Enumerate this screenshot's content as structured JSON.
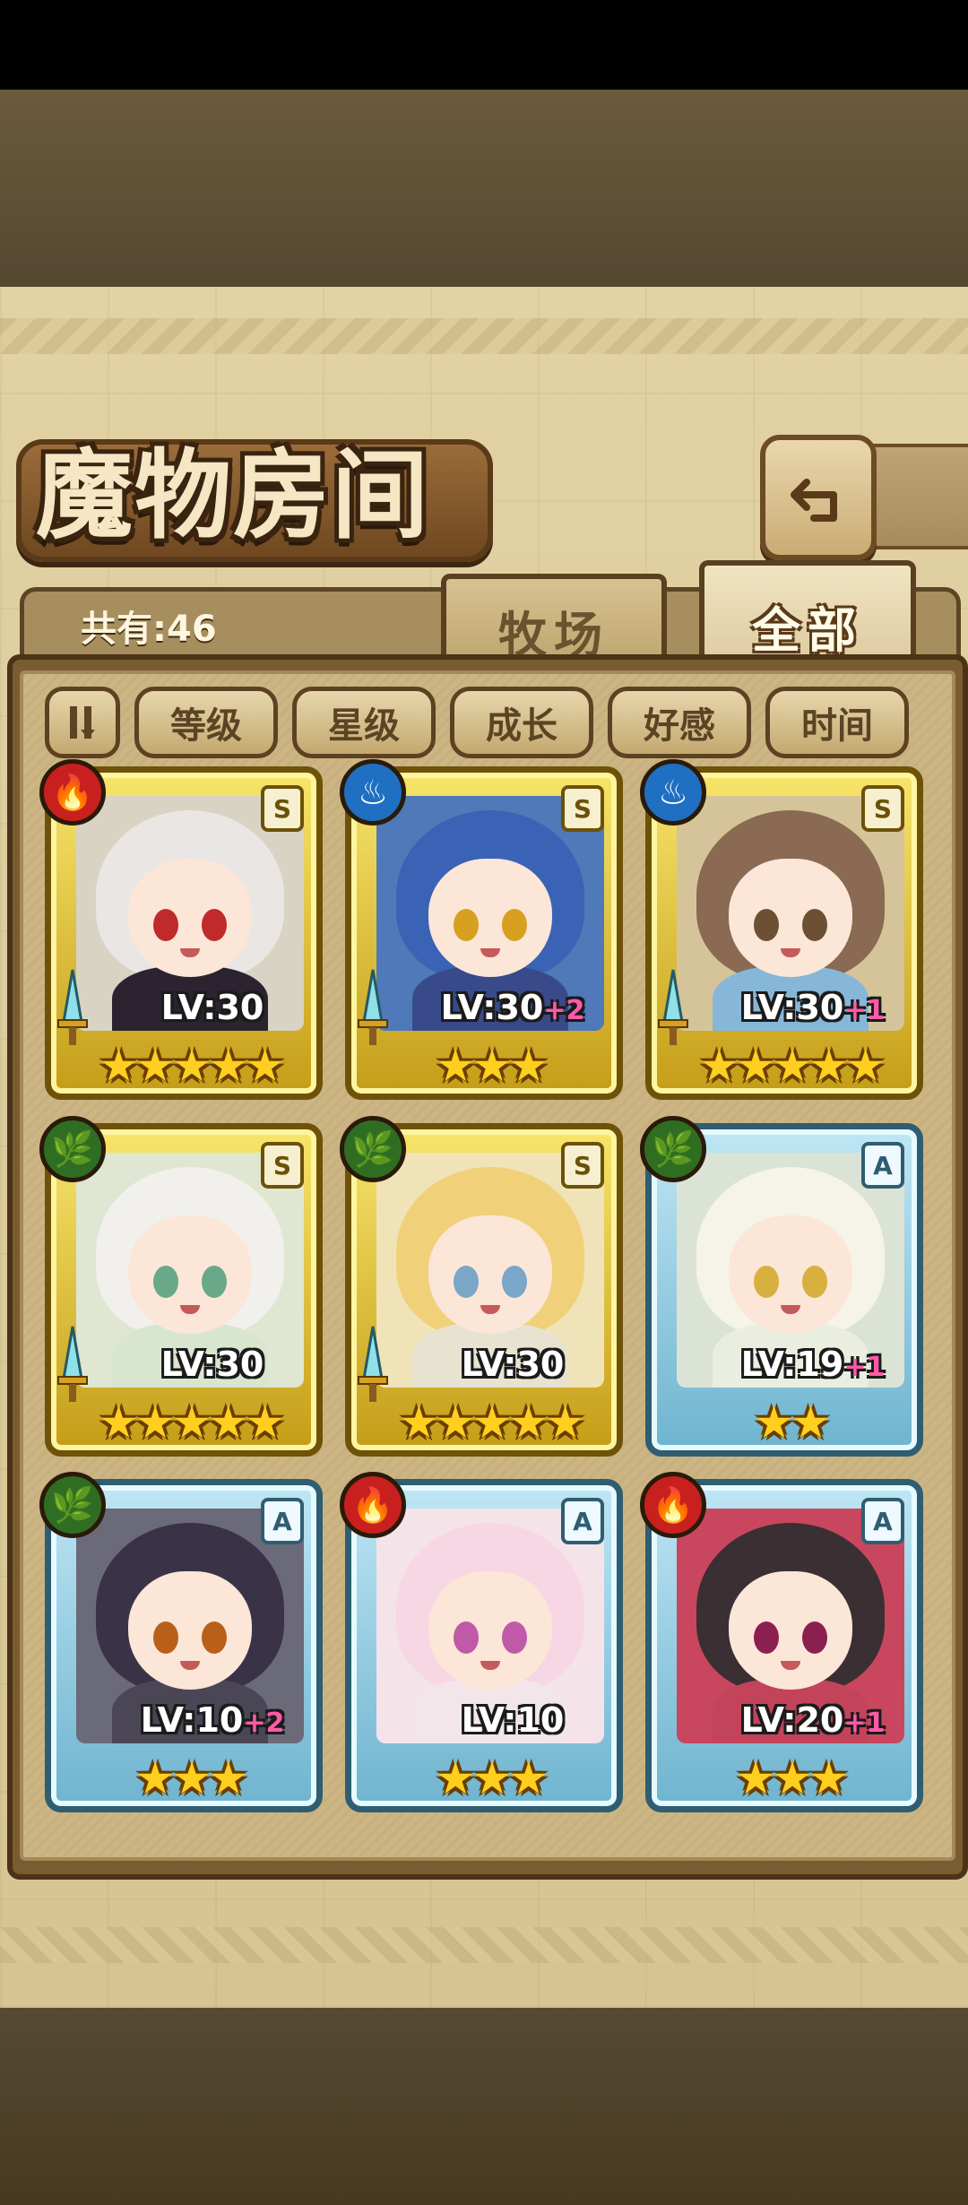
{
  "header": {
    "title": "魔物房间",
    "back_icon": "return-arrow-icon"
  },
  "tabs": {
    "count_label": "共有:46",
    "ranch": "牧场",
    "all": "全部"
  },
  "sort": {
    "toggle_icon": "sort-order-icon",
    "buttons": [
      "等级",
      "星级",
      "成长",
      "好感",
      "时间"
    ]
  },
  "monsters": [
    {
      "rank": "S",
      "element": "fire",
      "level": "LV:30",
      "plus": "",
      "stars": "★★★★★",
      "frame": "gold",
      "weapon": true
    },
    {
      "rank": "S",
      "element": "water",
      "level": "LV:30",
      "plus": "+2",
      "stars": "★★★",
      "frame": "gold",
      "weapon": true
    },
    {
      "rank": "S",
      "element": "water",
      "level": "LV:30",
      "plus": "+1",
      "stars": "★★★★★",
      "frame": "gold",
      "weapon": true
    },
    {
      "rank": "S",
      "element": "wood",
      "level": "LV:30",
      "plus": "",
      "stars": "★★★★★",
      "frame": "gold",
      "weapon": true
    },
    {
      "rank": "S",
      "element": "wood",
      "level": "LV:30",
      "plus": "",
      "stars": "★★★★★",
      "frame": "gold",
      "weapon": true
    },
    {
      "rank": "A",
      "element": "wood",
      "level": "LV:19",
      "plus": "+1",
      "stars": "★★",
      "frame": "blue",
      "weapon": false
    },
    {
      "rank": "A",
      "element": "wood",
      "level": "LV:10",
      "plus": "+2",
      "stars": "★★★",
      "frame": "blue",
      "weapon": false
    },
    {
      "rank": "A",
      "element": "fire",
      "level": "LV:10",
      "plus": "",
      "stars": "★★★",
      "frame": "blue",
      "weapon": false
    },
    {
      "rank": "A",
      "element": "fire",
      "level": "LV:20",
      "plus": "+1",
      "stars": "★★★",
      "frame": "blue",
      "weapon": false
    }
  ]
}
